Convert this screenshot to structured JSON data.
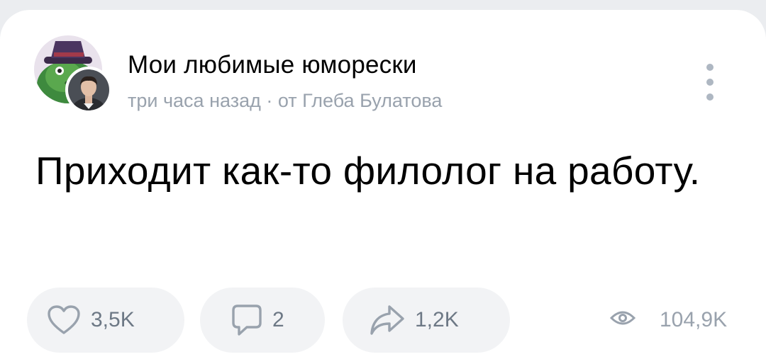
{
  "post": {
    "group_name": "Мои любимые юморески",
    "time": "три часа назад",
    "separator": " · ",
    "author": "от Глеба Булатова",
    "text": "Приходит как‑то филолог на работу."
  },
  "actions": {
    "likes": "3,5K",
    "comments": "2",
    "shares": "1,2K",
    "views": "104,9K"
  },
  "icons": {
    "like": "heart-icon",
    "comment": "comment-icon",
    "share": "share-arrow-icon",
    "views": "eye-icon",
    "more": "more-vertical-icon"
  },
  "colors": {
    "secondary_text": "#99a2ad",
    "action_bg": "#f2f3f5",
    "icon": "#99a2ad"
  }
}
